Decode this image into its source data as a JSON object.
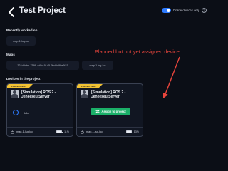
{
  "header": {
    "title": "Test Project",
    "online_toggle_label": "Online devices only",
    "help_icon": "help-circle-icon"
  },
  "sections": {
    "recent": "Recently worked on",
    "maps": "Maps",
    "devices": "Devices in the project"
  },
  "recent_chips": [
    "map-1-lsg-loc"
  ],
  "map_chips": [
    "324d9dbe-7599-4d5c-9145-9bd9d98e6f15",
    "map-1-lsg-loc"
  ],
  "annotation": "Planned but not yet assigned device",
  "devices": [
    {
      "badge": "LOW BATTERY",
      "name": "[Simulation] ROS 2 - Jeneeseu Server",
      "status": "Idle",
      "footer_map": "map-1-lsg-loc",
      "battery": "11%"
    },
    {
      "badge": "LOW BATTERY",
      "name": "[Simulation] ROS 2 - Jeneeseu Server",
      "action": "Assign to project",
      "footer_map": "map-1-lsg-loc",
      "battery": "13%"
    }
  ],
  "colors": {
    "background": "#0b0e16",
    "accent_blue": "#2e7bff",
    "badge_yellow": "#f2c233",
    "assign_green": "#1bb069",
    "annotation_red": "#e8453c"
  }
}
